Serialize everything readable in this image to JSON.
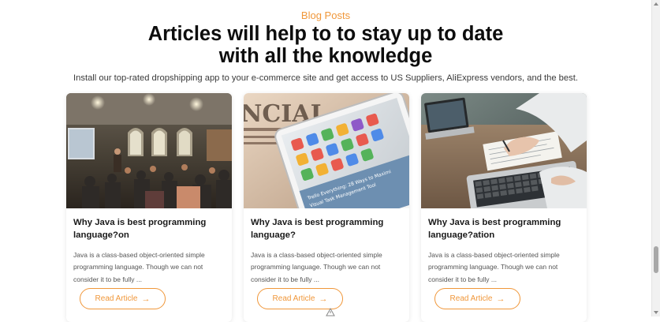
{
  "section": {
    "eyebrow": "Blog Posts",
    "headline_line1": "Articles will help to to stay up to date",
    "headline_line2": "with all the knowledge",
    "subtitle": "Install our top-rated dropshipping app to your e-commerce site and get access to US Suppliers, AliExpress vendors, and the best."
  },
  "cards": [
    {
      "image": "conference-room-photo",
      "title": "Why Java is best programming language?on",
      "excerpt": "Java is a class-based object-oriented simple programming language. Though we can not consider it to be fully ...",
      "button_label": "Read Article",
      "button_icon": "arrow-right-icon"
    },
    {
      "image": "tablet-newspaper-photo",
      "title": "Why Java is best programming language?",
      "excerpt": "Java is a class-based object-oriented simple programming language. Though we can not consider it to be fully ...",
      "button_label": "Read Article",
      "button_icon": "arrow-right-icon"
    },
    {
      "image": "laptop-notes-photo",
      "title": "Why Java is best programming language?ation",
      "excerpt": "Java is a class-based object-oriented simple programming language. Though we can not consider it to be fully ...",
      "button_label": "Read Article",
      "button_icon": "arrow-right-icon"
    }
  ],
  "photo_text": {
    "newspaper_masthead": "NCIAL",
    "tablet_line1": "Trello Everything: 28 Ways to Maximi",
    "tablet_line2": "Visual Task Management Tool"
  },
  "colors": {
    "accent": "#f0973a",
    "headline": "#0d0d0d",
    "body_text": "#555555"
  }
}
